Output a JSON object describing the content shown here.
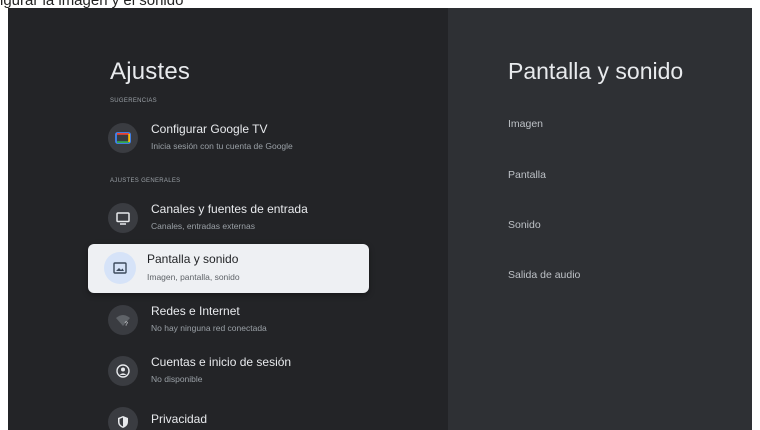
{
  "caption": "igurar la imagen y el sonido",
  "left_panel": {
    "title": "Ajustes",
    "sections": {
      "suggestions": "SUGERENCIAS",
      "general": "AJUSTES GENERALES"
    },
    "items": [
      {
        "label": "Configurar Google TV",
        "sub": "Inicia sesión con tu cuenta de Google",
        "icon": "google-tv-icon"
      },
      {
        "label": "Canales y fuentes de entrada",
        "sub": "Canales, entradas externas",
        "icon": "tv-icon"
      },
      {
        "label": "Pantalla y sonido",
        "sub": "Imagen, pantalla, sonido",
        "icon": "picture-icon"
      },
      {
        "label": "Redes e Internet",
        "sub": "No hay ninguna red conectada",
        "icon": "wifi-off-icon"
      },
      {
        "label": "Cuentas e inicio de sesión",
        "sub": "No disponible",
        "icon": "account-icon"
      },
      {
        "label": "Privacidad",
        "sub": "",
        "icon": "shield-icon"
      }
    ]
  },
  "right_panel": {
    "title": "Pantalla y sonido",
    "items": [
      "Imagen",
      "Pantalla",
      "Sonido",
      "Salida de audio"
    ]
  },
  "colors": {
    "background": "#232427",
    "right_pane": "#2e3034",
    "focused_card": "#eef0f3",
    "icon_circle": "#3a3c41"
  }
}
